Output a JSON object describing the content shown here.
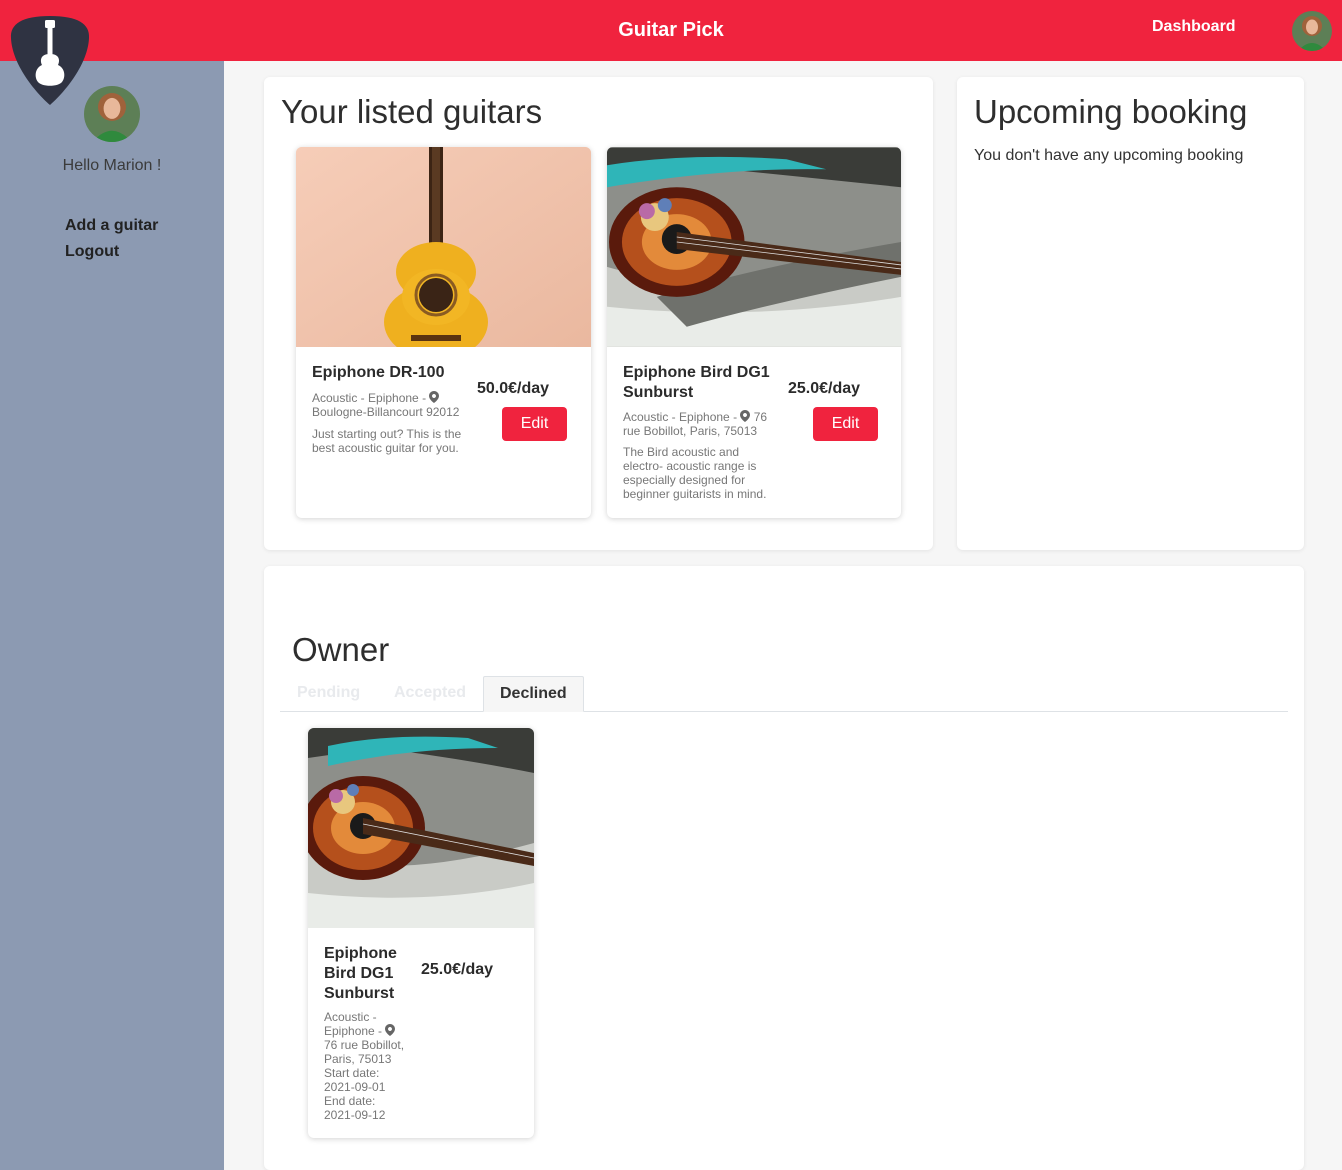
{
  "navbar": {
    "title": "Guitar Pick",
    "dashboard_link": "Dashboard"
  },
  "sidebar": {
    "greeting": "Hello Marion !",
    "menu": [
      "Add a guitar",
      "Logout"
    ]
  },
  "listed": {
    "title": "Your listed guitars",
    "edit_label": "Edit",
    "guitars": [
      {
        "name": "Epiphone DR-100",
        "price": "50.0€/day",
        "meta_line1": "Acoustic - Epiphone -",
        "meta_line2": "Boulogne-Billancourt 92012",
        "description": "Just starting out? This is the best acoustic guitar for you."
      },
      {
        "name": "Epiphone Bird DG1 Sunburst",
        "price": "25.0€/day",
        "meta_line1": "Acoustic - Epiphone -",
        "meta_line1b": "76",
        "meta_line2": "rue Bobillot, Paris, 75013",
        "description": "The Bird acoustic and electro- acoustic range is especially designed for beginner guitarists in mind."
      }
    ]
  },
  "upcoming": {
    "title": "Upcoming booking",
    "empty_text": "You don't have any upcoming booking"
  },
  "owner": {
    "title": "Owner",
    "tabs": [
      "Pending",
      "Accepted",
      "Declined"
    ],
    "active_tab": "Declined",
    "booking": {
      "name": "Epiphone Bird DG1 Sunburst",
      "price": "25.0€/day",
      "meta": "Acoustic - Epiphone -",
      "address": "76 rue Bobillot, Paris, 75013",
      "start_label": "Start date:",
      "start_date": "2021-09-01",
      "end_label": "End date:",
      "end_date": "2021-09-12"
    }
  },
  "colors": {
    "brand_red": "#f0233e",
    "sidebar": "#8c9ab2",
    "logo": "#2f3342"
  }
}
